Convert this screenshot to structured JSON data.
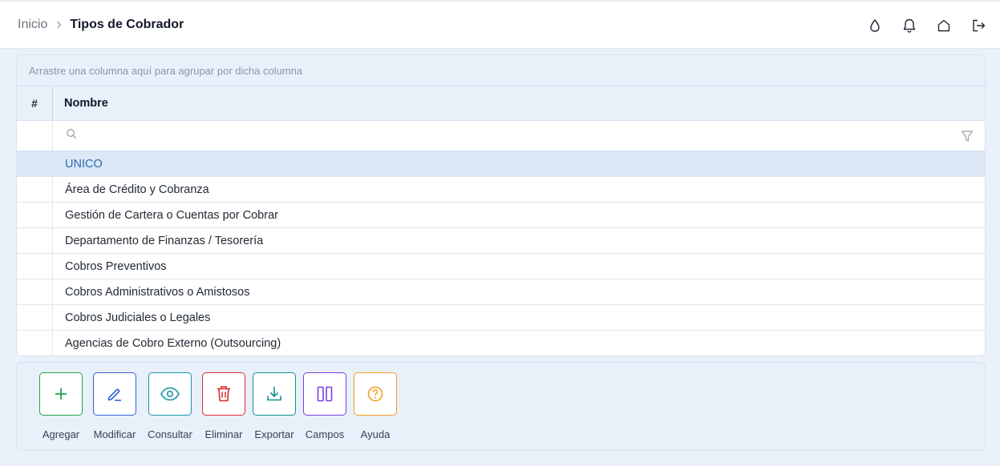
{
  "breadcrumb": {
    "root": "Inicio",
    "current": "Tipos de Cobrador"
  },
  "top_icons": [
    "theme-drop-icon",
    "bell-icon",
    "home-icon",
    "logout-icon"
  ],
  "grid": {
    "group_hint": "Arrastre una columna aquí para agrupar por dicha columna",
    "columns": [
      "#",
      "Nombre"
    ],
    "filter": {
      "value": "",
      "placeholder": ""
    },
    "rows": [
      "UNICO",
      "Área de Crédito y Cobranza",
      "Gestión de Cartera o Cuentas por Cobrar",
      "Departamento de Finanzas / Tesorería",
      "Cobros Preventivos",
      "Cobros Administrativos o Amistosos",
      "Cobros Judiciales o Legales",
      "Agencias de Cobro Externo (Outsourcing)"
    ],
    "selected_row": "UNICO"
  },
  "actions": [
    {
      "label": "Agregar",
      "icon": "plus-icon",
      "color": "#22a04b"
    },
    {
      "label": "Modificar",
      "icon": "pencil-icon",
      "color": "#3563d8"
    },
    {
      "label": "Consultar",
      "icon": "eye-icon",
      "color": "#1a94a8"
    },
    {
      "label": "Eliminar",
      "icon": "trash-icon",
      "color": "#d62f2f"
    },
    {
      "label": "Exportar",
      "icon": "download-icon",
      "color": "#11918a"
    },
    {
      "label": "Campos",
      "icon": "columns-icon",
      "color": "#7b3fe0"
    },
    {
      "label": "Ayuda",
      "icon": "help-icon",
      "color": "#f0a020"
    }
  ]
}
